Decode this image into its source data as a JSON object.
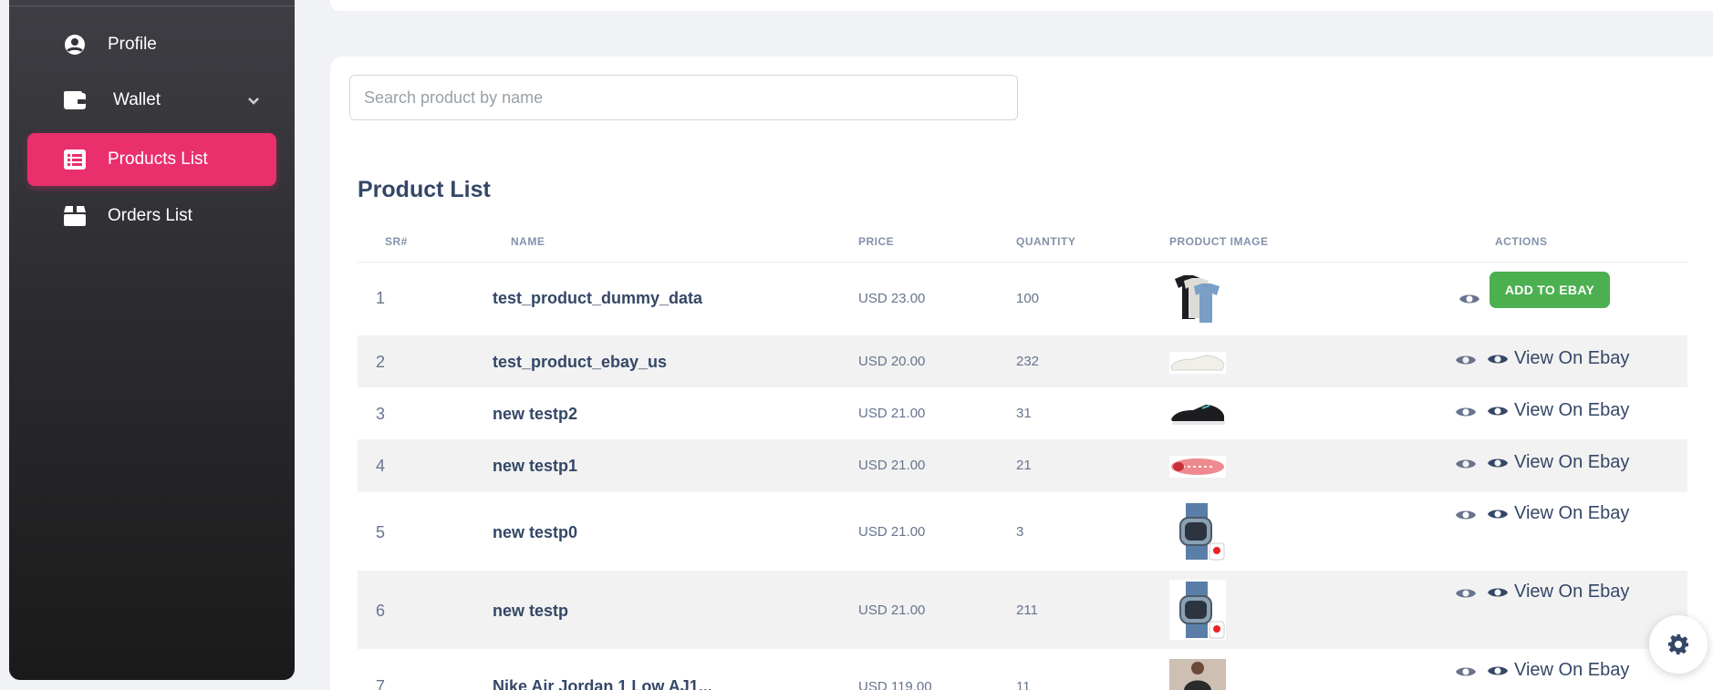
{
  "sidebar": {
    "items": [
      {
        "label": "Profile",
        "icon": "user-circle-icon"
      },
      {
        "label": "Wallet",
        "icon": "wallet-icon"
      },
      {
        "label": "Products List",
        "icon": "list-icon",
        "active": true
      },
      {
        "label": "Orders List",
        "icon": "box-icon"
      }
    ]
  },
  "search": {
    "placeholder": "Search product by name",
    "value": ""
  },
  "table": {
    "title": "Product List",
    "headers": [
      "SR#",
      "NAME",
      "PRICE",
      "QUANTITY",
      "PRODUCT IMAGE",
      "ACTIONS"
    ],
    "add_label": "ADD TO EBAY",
    "view_label": "View On Ebay",
    "rows": [
      {
        "sr": "1",
        "name": "test_product_dummy_data",
        "price": "USD 23.00",
        "qty": "100"
      },
      {
        "sr": "2",
        "name": "test_product_ebay_us",
        "price": "USD 20.00",
        "qty": "232"
      },
      {
        "sr": "3",
        "name": "new testp2",
        "price": "USD 21.00",
        "qty": "31"
      },
      {
        "sr": "4",
        "name": "new testp1",
        "price": "USD 21.00",
        "qty": "21"
      },
      {
        "sr": "5",
        "name": "new testp0",
        "price": "USD 21.00",
        "qty": "3"
      },
      {
        "sr": "6",
        "name": "new testp",
        "price": "USD 21.00",
        "qty": "211"
      },
      {
        "sr": "7",
        "name": "Nike Air Jordan 1 Low AJ1...",
        "price": "USD 119.00",
        "qty": "11"
      }
    ]
  },
  "colors": {
    "accent": "#e92f6c",
    "success": "#4caf50",
    "text": "#344767"
  }
}
